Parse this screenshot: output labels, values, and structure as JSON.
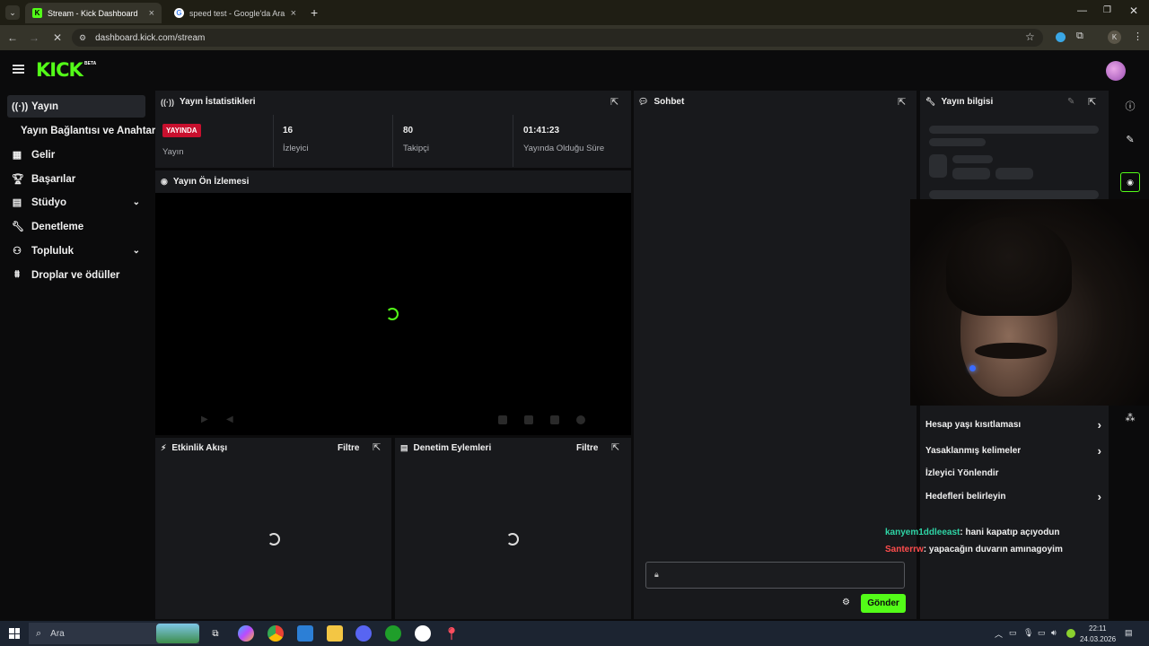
{
  "browser": {
    "tabs": [
      {
        "title": "Stream - Kick Dashboard",
        "close": "×"
      },
      {
        "title": "speed test - Google'da Ara",
        "close": "×"
      }
    ],
    "new_tab": "+",
    "url": "dashboard.kick.com/stream",
    "profile_letter": "K"
  },
  "header": {
    "logo": "KICK",
    "beta": "BETA"
  },
  "sidebar": {
    "items": [
      {
        "label": "Yayın",
        "icon": "broadcast-icon"
      },
      {
        "label": "Yayın Bağlantısı ve Anahtarı"
      },
      {
        "label": "Gelir",
        "icon": "revenue-icon"
      },
      {
        "label": "Başarılar",
        "icon": "trophy-icon"
      },
      {
        "label": "Stüdyo",
        "icon": "studio-icon"
      },
      {
        "label": "Denetleme",
        "icon": "wrench-icon"
      },
      {
        "label": "Topluluk",
        "icon": "community-icon"
      },
      {
        "label": "Droplar ve ödüller",
        "icon": "drops-icon"
      }
    ]
  },
  "stats": {
    "title": "Yayın İstatistikleri",
    "live_badge": "YAYINDA",
    "live_label": "Yayın",
    "viewers_value": "16",
    "viewers_label": "İzleyici",
    "followers_value": "80",
    "followers_label": "Takipçi",
    "uptime_value": "01:41:23",
    "uptime_label": "Yayında Olduğu Süre"
  },
  "preview": {
    "title": "Yayın Ön İzlemesi"
  },
  "activity": {
    "title": "Etkinlik Akışı",
    "filter": "Filtre"
  },
  "moderation": {
    "title": "Denetim Eylemleri",
    "filter": "Filtre"
  },
  "chat": {
    "title": "Sohbet",
    "send": "Gönder",
    "messages": [
      {
        "user": "kanyem1ddleeast",
        "user_color": "#2fd5a6",
        "text": ": hani kapatıp açıyodun"
      },
      {
        "user": "Santerrw",
        "user_color": "#ff4d4d",
        "text": ": yapacağın duvarın amınagoyim"
      }
    ]
  },
  "info": {
    "title": "Yayın bilgisi",
    "menu": [
      {
        "label": "Hesap yaşı kısıtlaması",
        "arrow": "›"
      },
      {
        "label": "Yasaklanmış kelimeler",
        "arrow": "›"
      },
      {
        "label": "İzleyici Yönlendir",
        "arrow": ""
      },
      {
        "label": "Hedefleri belirleyin",
        "arrow": "›"
      }
    ]
  },
  "taskbar": {
    "search_placeholder": "Ara",
    "time": "22:11",
    "date": "24.03.2026"
  },
  "colors": {
    "accent": "#53fc18",
    "live": "#c8102e",
    "panel": "#18191c",
    "bg": "#0b0b0c"
  }
}
